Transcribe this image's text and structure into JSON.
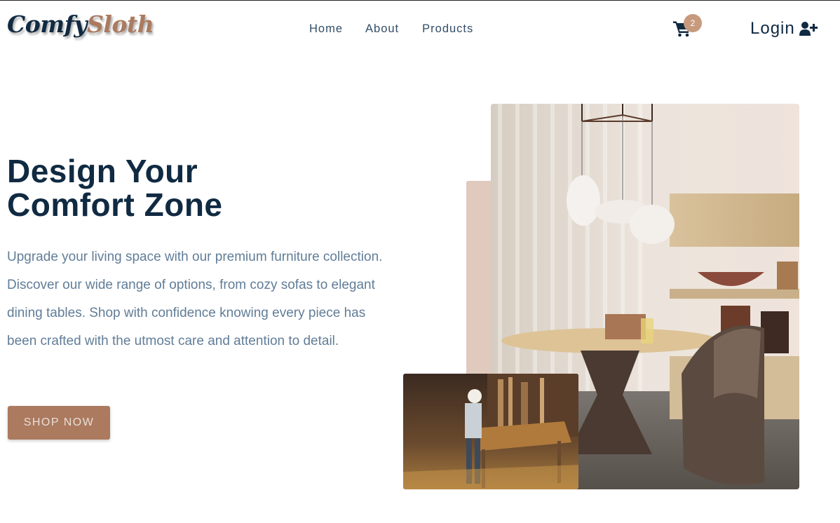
{
  "brand": {
    "logo_part1": "Comfy",
    "logo_part2": "Sloth"
  },
  "nav": {
    "links": [
      {
        "label": "Home"
      },
      {
        "label": "About"
      },
      {
        "label": "Products"
      }
    ]
  },
  "cart": {
    "count": "2",
    "icon": "shopping-cart-icon"
  },
  "login": {
    "label": "Login",
    "icon": "user-plus-icon"
  },
  "hero": {
    "title_line1": "Design Your",
    "title_line2": "Comfort Zone",
    "text": "Upgrade your living space with our premium furniture collection. Discover our wide range of options, from cozy sofas to elegant dining tables. Shop with confidence knowing every piece has been crafted with the utmost care and attention to detail.",
    "button_label": "SHOP NOW"
  },
  "colors": {
    "primary_dark": "#102a42",
    "brand_brown": "#ab7a5f",
    "text_muted": "#617d98",
    "badge": "#c79a7d",
    "accent_bar": "#e0c9bd"
  }
}
